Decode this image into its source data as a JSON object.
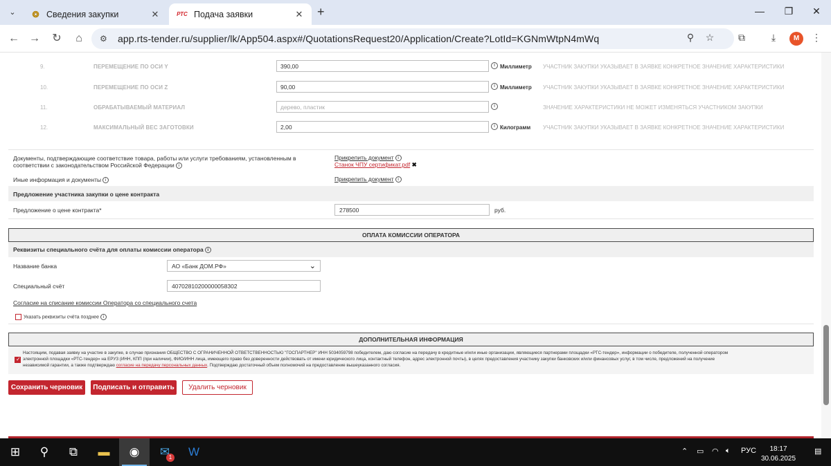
{
  "browser": {
    "tabs": [
      {
        "title": "Сведения закупки",
        "favicon": "emblem-icon",
        "active": false
      },
      {
        "title": "Подача заявки",
        "favicon_text": "РТС",
        "active": true
      }
    ],
    "url": "app.rts-tender.ru/supplier/lk/App504.aspx#/QuotationsRequest20/Application/Create?LotId=KGNmWtpN4mWq",
    "profile_initial": "M"
  },
  "characteristics": [
    {
      "num": "9.",
      "name": "ПЕРЕМЕЩЕНИЕ ПО ОСИ Y",
      "value": "390,00",
      "placeholder": "",
      "unit": "Миллиметр",
      "note": "УЧАСТНИК ЗАКУПКИ УКАЗЫВАЕТ В ЗАЯВКЕ КОНКРЕТНОЕ ЗНАЧЕНИЕ ХАРАКТЕРИСТИКИ"
    },
    {
      "num": "10.",
      "name": "ПЕРЕМЕЩЕНИЕ ПО ОСИ Z",
      "value": "90,00",
      "placeholder": "",
      "unit": "Миллиметр",
      "note": "УЧАСТНИК ЗАКУПКИ УКАЗЫВАЕТ В ЗАЯВКЕ КОНКРЕТНОЕ ЗНАЧЕНИЕ ХАРАКТЕРИСТИКИ"
    },
    {
      "num": "11.",
      "name": "ОБРАБАТЫВАЕМЫЙ МАТЕРИАЛ",
      "value": "",
      "placeholder": "дерево, пластик",
      "unit": "",
      "note": "ЗНАЧЕНИЕ ХАРАКТЕРИСТИКИ НЕ МОЖЕТ ИЗМЕНЯТЬСЯ УЧАСТНИКОМ ЗАКУПКИ"
    },
    {
      "num": "12.",
      "name": "МАКСИМАЛЬНЫЙ ВЕС ЗАГОТОВКИ",
      "value": "2,00",
      "placeholder": "",
      "unit": "Килограмм",
      "note": "УЧАСТНИК ЗАКУПКИ УКАЗЫВАЕТ В ЗАЯВКЕ КОНКРЕТНОЕ ЗНАЧЕНИЕ ХАРАКТЕРИСТИКИ"
    }
  ],
  "documents": {
    "compliance_label_1": "Документы, подтверждающие соответствие товара, работы или услуги требованиям, установленным в",
    "compliance_label_2": "соответствии с законодательством Российской Федерации",
    "attach_link": "Прикрепить документ",
    "attached_file": "Станок ЧПУ сертификат.pdf",
    "other_label": "Иные информация и документы",
    "other_attach_link": "Прикрепить документ"
  },
  "price_offer": {
    "section_title": "Предложение участника закупки о цене контракта",
    "label": "Предложение о цене контракта*",
    "value": "278500",
    "currency": "руб."
  },
  "commission": {
    "header": "ОПЛАТА КОМИССИИ ОПЕРАТОРА",
    "requisites_title": "Реквизиты специального счёта для оплаты комиссии оператора",
    "bank_label": "Название банка",
    "bank_value": "АО «Банк ДОМ.РФ»",
    "account_label": "Специальный счёт",
    "account_value": "40702810200000058302",
    "consent_link": "Согласие на списание комиссии Оператора со специального счета",
    "later_checkbox_label": "Указать реквизиты счёта позднее"
  },
  "additional": {
    "header": "ДОПОЛНИТЕЛЬНАЯ ИНФОРМАЦИЯ",
    "consent_text_1": "Настоящим, подавая заявку на участие в закупке, в случае признания ОБЩЕСТВО С ОГРАНИЧЕННОЙ ОТВЕТСТВЕННОСТЬЮ \"ГОСПАРТНЕР\" ИНН 5034059798 победителем, даю согласие на передачу в кредитные и/или иные организации, являющиеся партнерами площадки «РТС-тендер», информации о победителе, полученной оператором",
    "consent_text_2": "электронной площадки «РТС-тендер» на ЕРУЗ (ИНН, КПП (при наличии), ФИО/ИНН лица, имеющего право без доверенности действовать от имени юридического лица, контактный телефон, адрес электронной почты), в целях предоставления участнику закупки банковских и/или финансовых услуг, в том числе, предложений на получение",
    "consent_text_3a": "независимой гарантии, а также подтверждаю ",
    "consent_link": "согласие на передачу персональных данных",
    "consent_text_3b": ". Подтверждаю достаточный объем полномочий на предоставление вышеуказанного согласия."
  },
  "actions": {
    "save_draft": "Сохранить черновик",
    "sign_send": "Подписать и отправить",
    "delete_draft": "Удалить черновик"
  },
  "taskbar": {
    "language": "РУС",
    "time": "18:17",
    "date": "30.06.2025",
    "mail_badge": "1"
  },
  "colors": {
    "accent": "#c3262f",
    "header_bg": "#efefef"
  }
}
